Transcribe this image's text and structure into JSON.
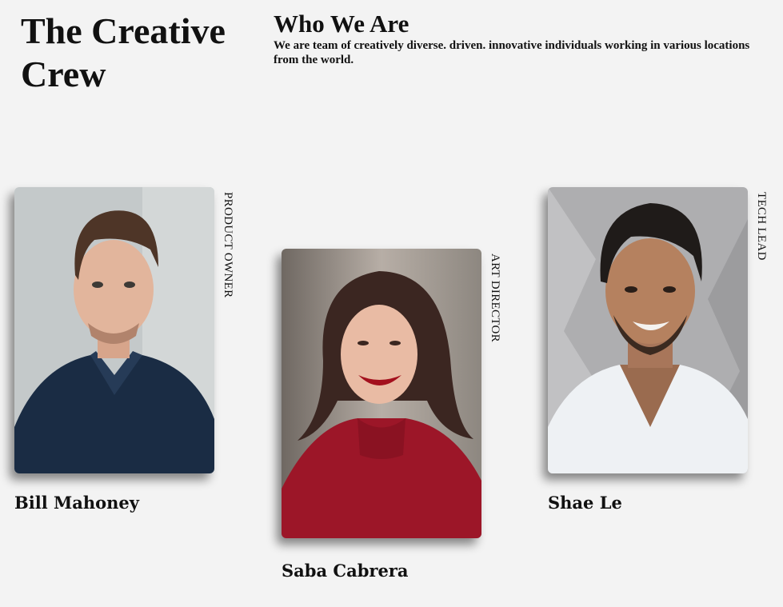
{
  "header": {
    "brand_title": "The Creative Crew",
    "section_title": "Who We Are",
    "section_text": "We are team of creatively diverse. driven. innovative individuals working in various locations from the world."
  },
  "team": [
    {
      "name": "Bill Mahoney",
      "role": "PRODUCT OWNER"
    },
    {
      "name": "Saba Cabrera",
      "role": "ART DIRECTOR"
    },
    {
      "name": "Shae Le",
      "role": "TECH LEAD"
    }
  ]
}
